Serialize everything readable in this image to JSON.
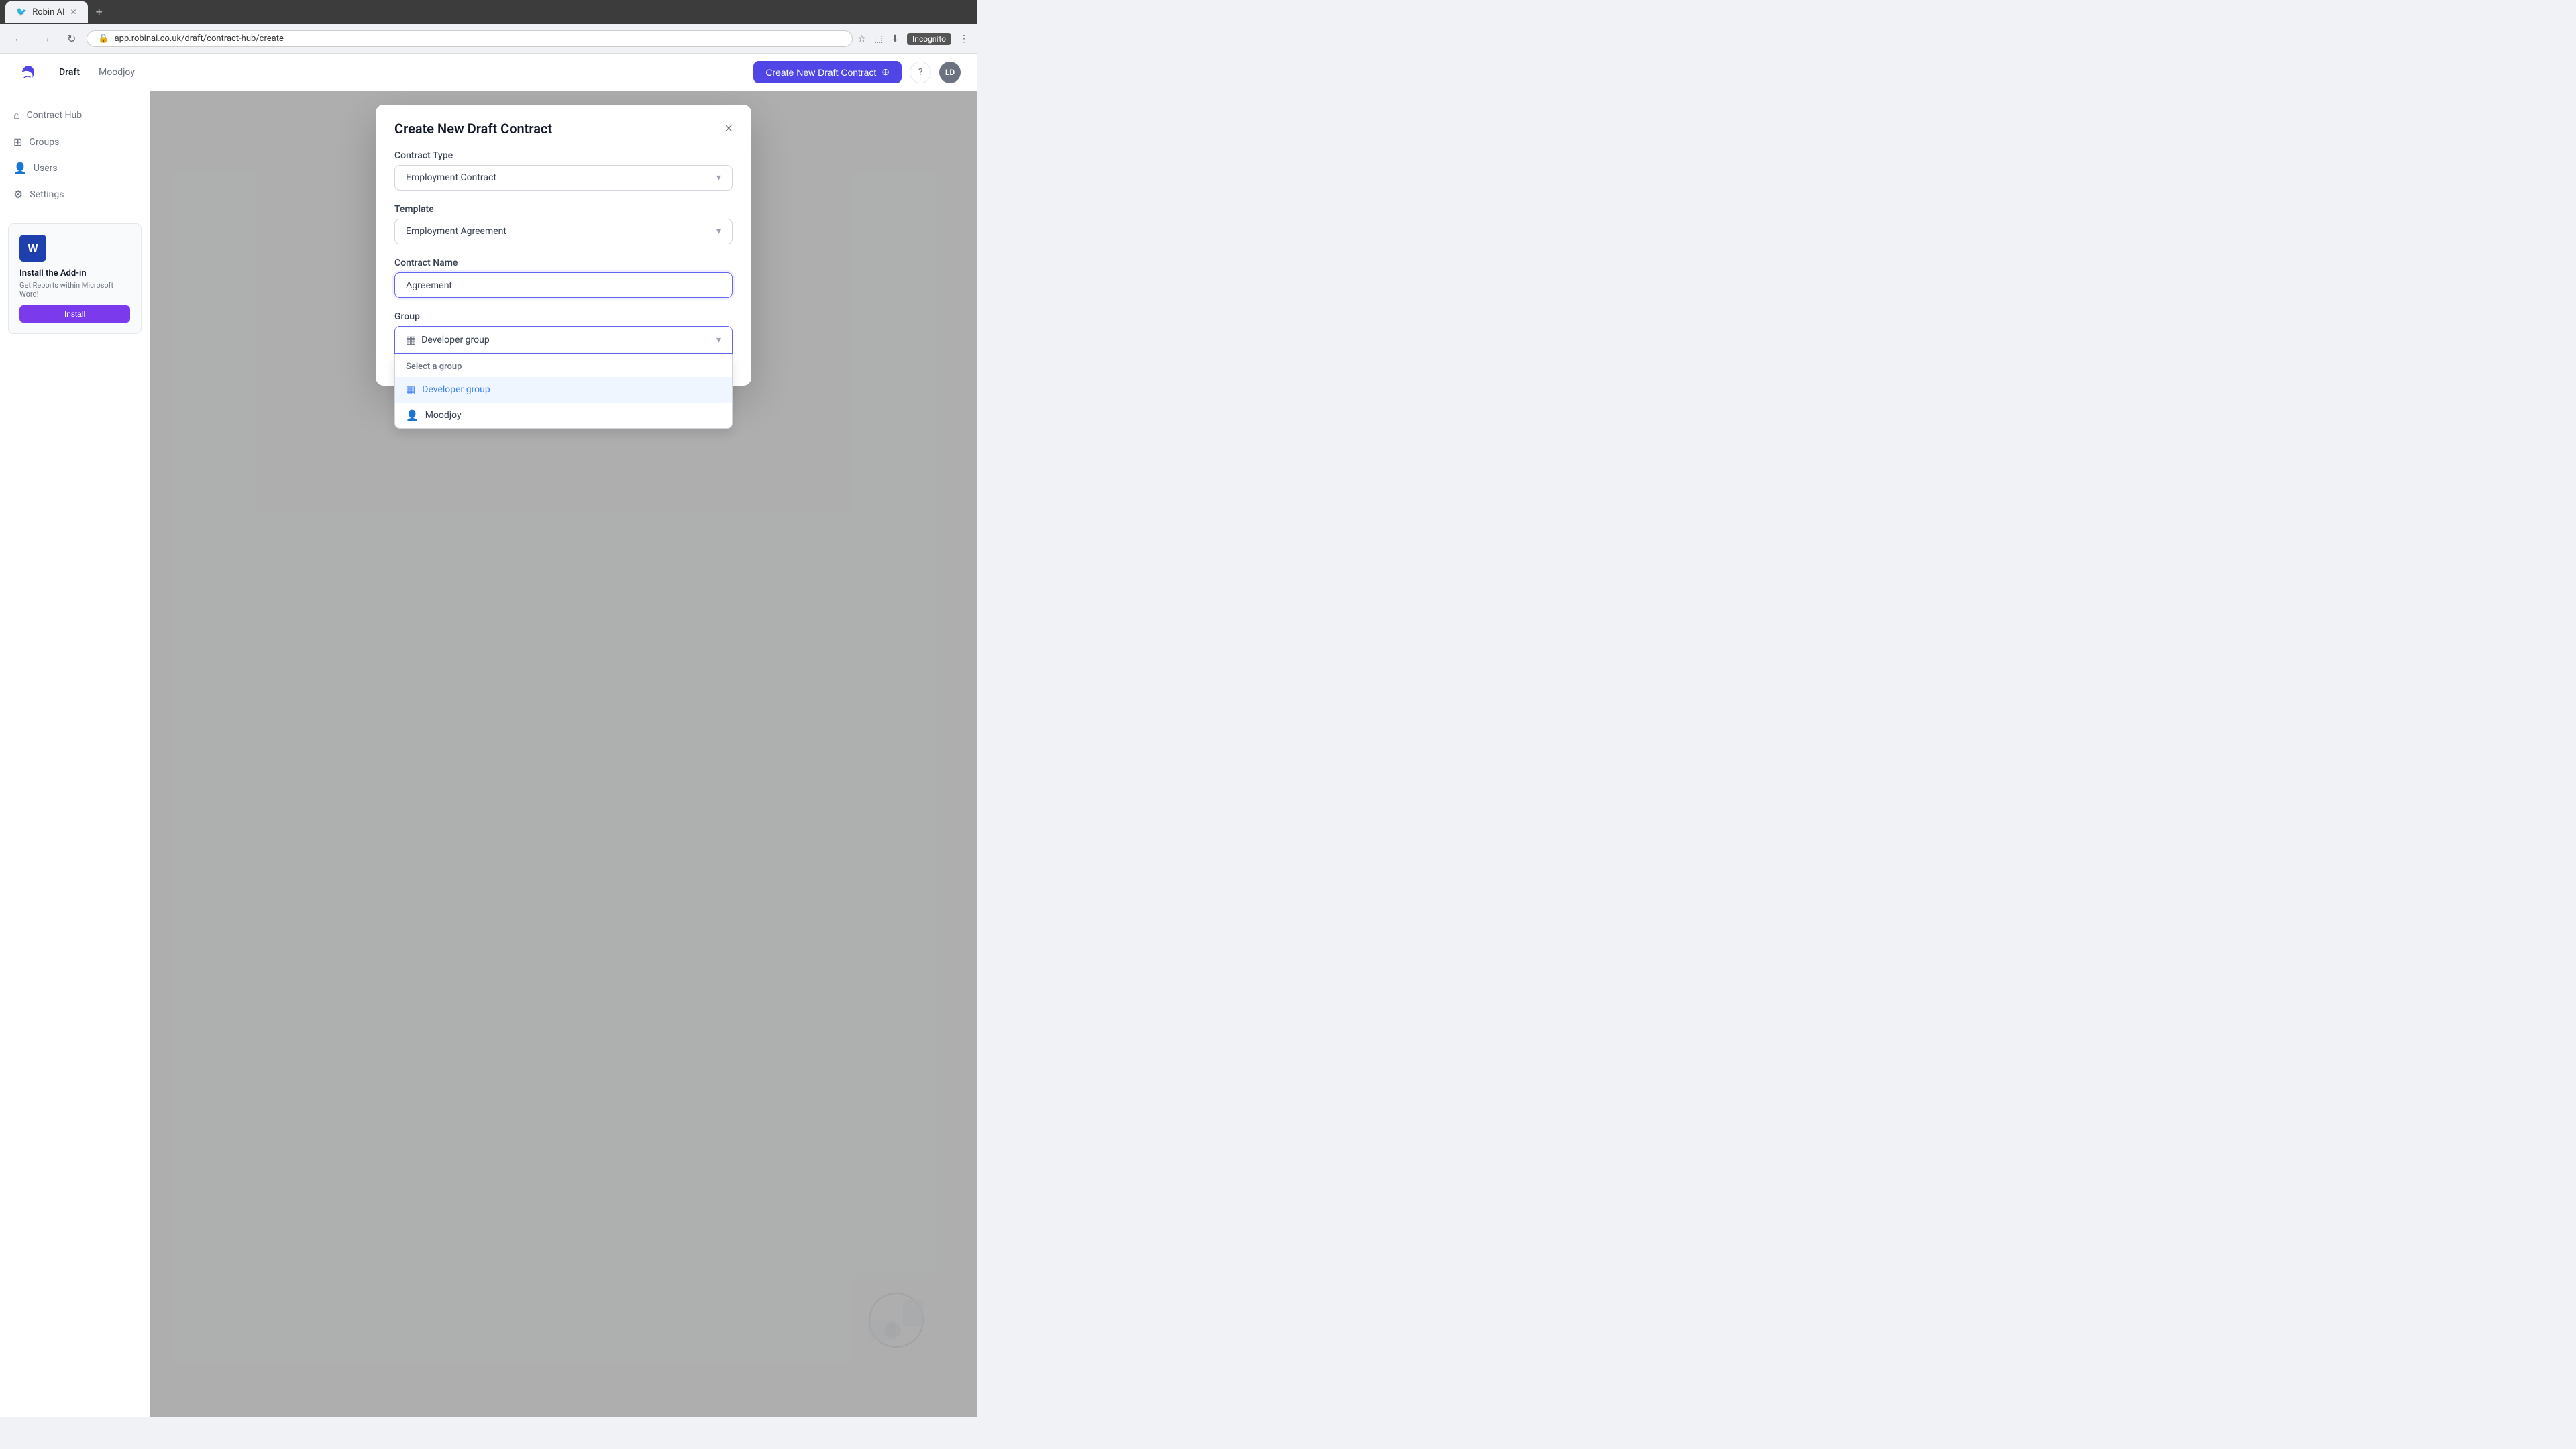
{
  "browser": {
    "tab_label": "Robin AI",
    "tab_favicon": "🐦",
    "url": "app.robinai.co.uk/draft/contract-hub/create",
    "incognito_label": "Incognito",
    "new_tab_icon": "+"
  },
  "header": {
    "logo_alt": "Robin AI",
    "nav_items": [
      {
        "label": "Draft",
        "active": true
      },
      {
        "label": "Moodjoy",
        "active": false
      }
    ],
    "create_button_label": "Create New Draft Contract",
    "help_icon": "?",
    "avatar_initials": "LD"
  },
  "sidebar": {
    "items": [
      {
        "label": "Contract Hub",
        "icon": "⌂",
        "active": false
      },
      {
        "label": "Groups",
        "icon": "⊞",
        "active": false
      },
      {
        "label": "Users",
        "icon": "👤",
        "active": false
      },
      {
        "label": "Settings",
        "icon": "⚙",
        "active": false
      }
    ],
    "addon": {
      "icon": "W",
      "title": "Install the Add-in",
      "description": "Get Reports within Microsoft Word!",
      "button_label": "Install"
    }
  },
  "modal": {
    "title": "Create New Draft Contract",
    "close_icon": "×",
    "contract_type_label": "Contract Type",
    "contract_type_value": "Employment Contract",
    "template_label": "Template",
    "template_value": "Employment Agreement",
    "contract_name_label": "Contract Name",
    "contract_name_value": "Agreement",
    "group_label": "Group",
    "group_value": "Developer group",
    "dropdown": {
      "header": "Select a group",
      "items": [
        {
          "label": "Developer group",
          "selected": true
        },
        {
          "label": "Moodjoy",
          "selected": false
        }
      ]
    }
  },
  "icons": {
    "chevron_down": "▾",
    "plus": "+",
    "group_table": "▦",
    "question": "?",
    "bird_logo": "🐦",
    "home": "⌂",
    "grid": "⊞",
    "user": "👤",
    "gear": "⚙",
    "close": "×",
    "word": "W",
    "back": "←",
    "forward": "→",
    "reload": "↻",
    "star": "☆",
    "extension": "⬚",
    "download": "⬇",
    "menu": "⋮",
    "lock": "🔒"
  }
}
